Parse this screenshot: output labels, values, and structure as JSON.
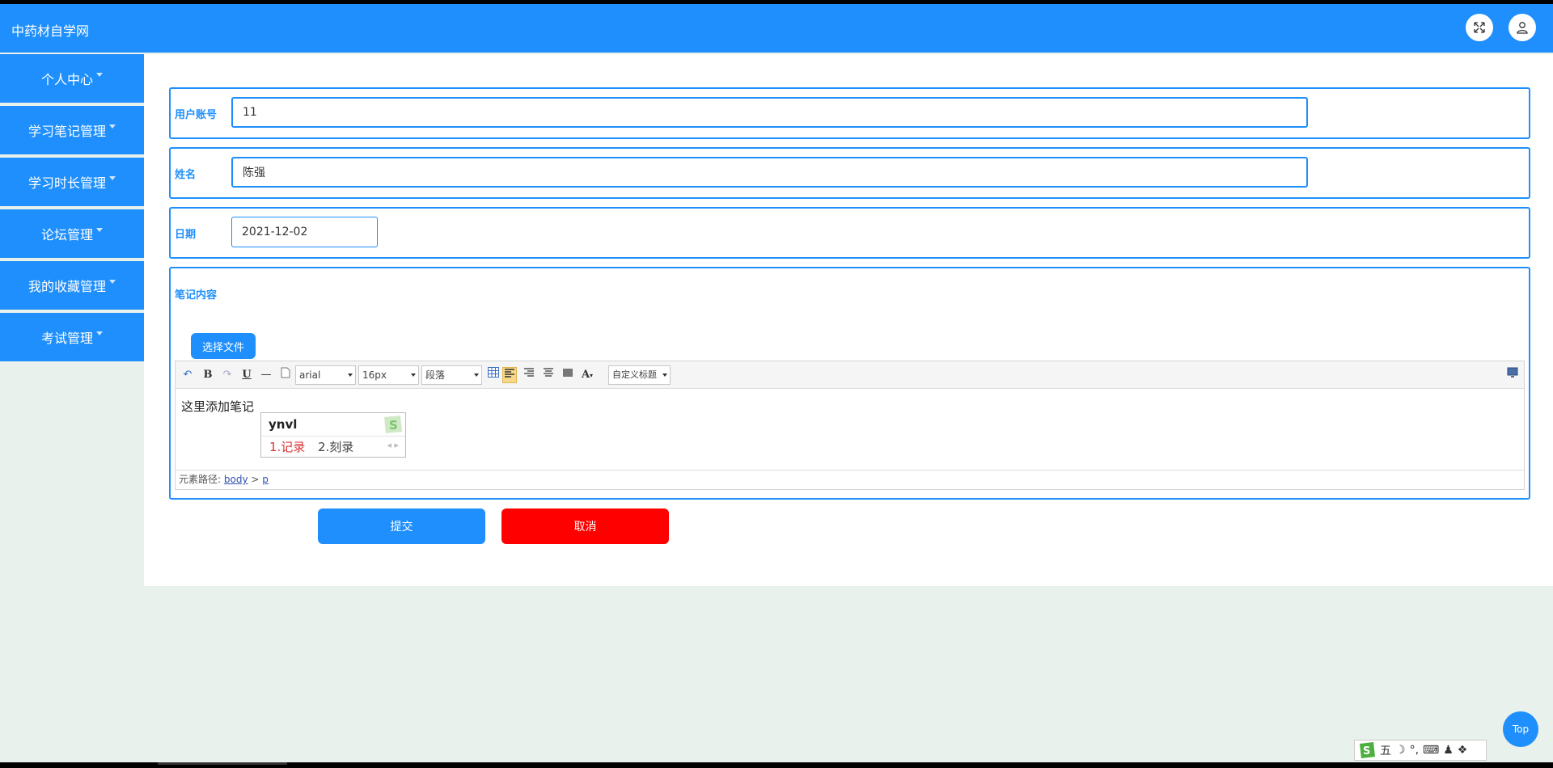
{
  "header": {
    "brand": "中药材自学网",
    "fullscreen_icon": "expand-icon",
    "user_icon": "user-icon"
  },
  "sidebar": {
    "items": [
      {
        "label": "个人中心"
      },
      {
        "label": "学习笔记管理"
      },
      {
        "label": "学习时长管理"
      },
      {
        "label": "论坛管理"
      },
      {
        "label": "我的收藏管理"
      },
      {
        "label": "考试管理"
      }
    ]
  },
  "form": {
    "account": {
      "label": "用户账号",
      "value": "11"
    },
    "name": {
      "label": "姓名",
      "value": "陈强"
    },
    "date": {
      "label": "日期",
      "value": "2021-12-02"
    },
    "note": {
      "label": "笔记内容",
      "file_button": "选择文件"
    }
  },
  "editor": {
    "toolbar": {
      "undo": "↶",
      "bold": "B",
      "redo": "↷",
      "underline": "U",
      "hr": "—",
      "font_family": "arial",
      "font_size": "16px",
      "paragraph": "段落",
      "font_color": "A",
      "custom_title": "自定义标题"
    },
    "content": "这里添加笔记",
    "element_path": {
      "label": "元素路径:",
      "body": "body",
      "sep": ">",
      "p": "p"
    }
  },
  "ime": {
    "composition": "ynvl",
    "candidates": [
      "1.记录",
      "2.刻录"
    ],
    "nav": "◂ ▸",
    "status": [
      "五",
      "☽",
      "°,",
      "⌨",
      "♟",
      "❖"
    ]
  },
  "actions": {
    "submit": "提交",
    "cancel": "取消",
    "top": "Top"
  },
  "colors": {
    "primary": "#1e8ffc",
    "danger": "#ff0000",
    "page_bg": "#e8f1ec"
  }
}
